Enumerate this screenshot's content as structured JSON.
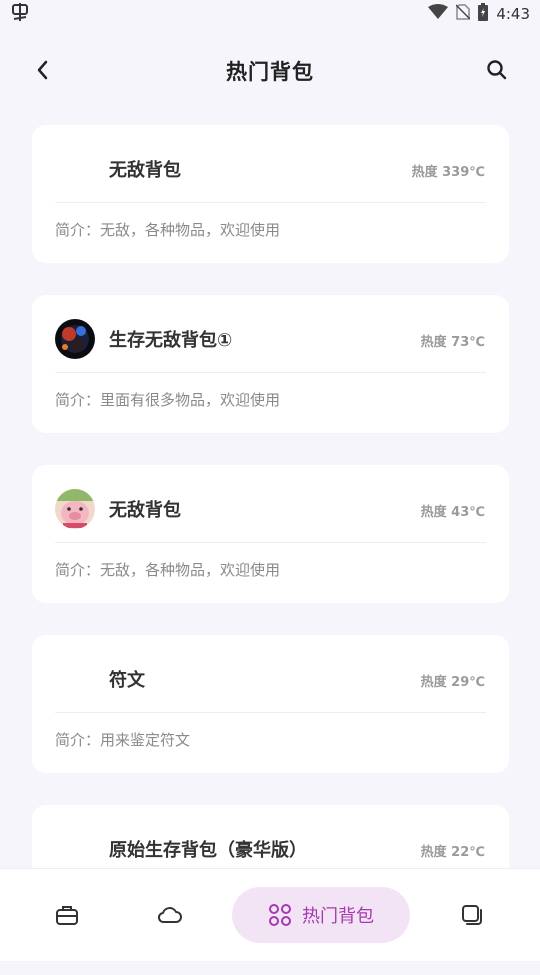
{
  "status_bar": {
    "left_icon": "bug-app-icon",
    "time": "4:43",
    "icons": [
      "wifi-icon",
      "no-sim-icon",
      "battery-icon"
    ]
  },
  "header": {
    "title": "热门背包",
    "back_icon": "chevron-left-icon",
    "search_icon": "search-icon"
  },
  "cards": [
    {
      "title": "无敌背包",
      "heat": "热度 339℃",
      "desc": "简介：无敌，各种物品，欢迎使用",
      "avatar": "none"
    },
    {
      "title": "生存无敌背包①",
      "heat": "热度 73℃",
      "desc": "简介：里面有很多物品，欢迎使用",
      "avatar": "space-avatar"
    },
    {
      "title": "无敌背包",
      "heat": "热度 43℃",
      "desc": "简介：无敌，各种物品，欢迎使用",
      "avatar": "pig-avatar"
    },
    {
      "title": "符文",
      "heat": "热度 29℃",
      "desc": "简介：用来鉴定符文",
      "avatar": "none"
    },
    {
      "title": "原始生存背包（豪华版）",
      "heat": "热度 22℃",
      "desc": "",
      "avatar": "none"
    }
  ],
  "bottom_nav": {
    "items": [
      {
        "icon": "briefcase-icon"
      },
      {
        "icon": "cloud-icon"
      },
      {
        "icon": "grid-icon",
        "label": "热门背包",
        "active": true
      },
      {
        "icon": "layers-icon"
      }
    ],
    "active_color": "#a43ab0",
    "active_bg": "#f3e4f5"
  }
}
